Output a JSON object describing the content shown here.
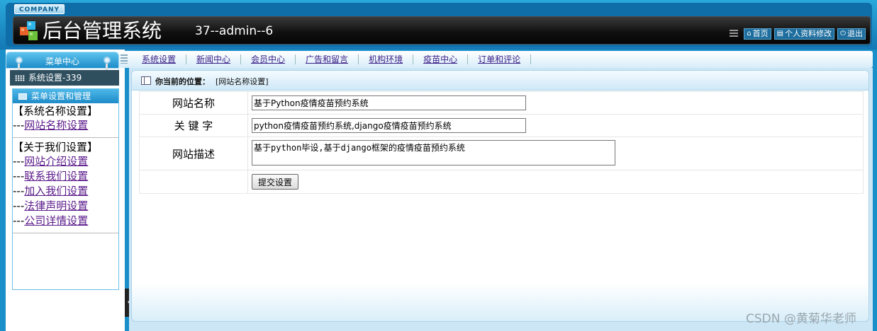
{
  "header": {
    "company_tag": "COMPANY",
    "app_title": "后台管理系统",
    "user_info": "37--admin--6",
    "links": [
      {
        "label": "首页",
        "icon": "home-icon"
      },
      {
        "label": "个人资料修改",
        "icon": "document-icon"
      },
      {
        "label": "退出",
        "icon": "power-icon"
      }
    ]
  },
  "sidebar": {
    "menu_center": "菜单中心",
    "system_bar": "系统设置-339",
    "menu_box_title": "菜单设置和管理",
    "groups": [
      {
        "title": "【系统名称设置】",
        "prefix": "---",
        "items": [
          "网站名称设置"
        ]
      },
      {
        "title": "【关于我们设置】",
        "prefix": "---",
        "items": [
          "网站介绍设置",
          "联系我们设置",
          "加入我们设置",
          "法律声明设置",
          "公司详情设置"
        ]
      }
    ]
  },
  "nav": {
    "items": [
      "系统设置",
      "新闻中心",
      "会员中心",
      "广告和留言",
      "机构环境",
      "疫苗中心",
      "订单和评论"
    ]
  },
  "breadcrumb": {
    "label": "你当前的位置：",
    "value": "[网站名称设置]"
  },
  "form": {
    "site_name_label": "网站名称",
    "site_name_value": "基于Python疫情疫苗预约系统",
    "keywords_label": "关 键 字",
    "keywords_value": "python疫情疫苗预约系统,django疫情疫苗预约系统",
    "description_label": "网站描述",
    "description_value": "基于python毕设,基于django框架的疫情疫苗预约系统",
    "submit_label": "提交设置"
  },
  "watermark": "CSDN @黄菊华老师",
  "colors": {
    "header_blue": "#1478b4",
    "title_bar": "#111111",
    "link_purple": "#5b1a8a"
  }
}
